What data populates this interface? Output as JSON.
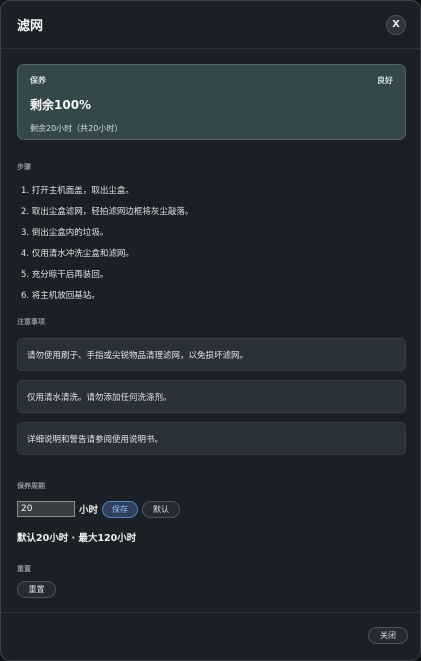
{
  "dialog": {
    "title": "滤网",
    "close_x": "X"
  },
  "status": {
    "label": "保养",
    "condition": "良好",
    "remaining": "剩余100%",
    "detail": "剩余20小时（共20小时）",
    "progress_percent": 100
  },
  "steps": {
    "label": "步骤",
    "items": [
      "1. 打开主机面盖，取出尘盒。",
      "2. 取出尘盒滤网，轻拍滤网边框将灰尘敲落。",
      "3. 倒出尘盒内的垃圾。",
      "4. 仅用清水冲洗尘盒和滤网。",
      "5. 充分晾干后再装回。",
      "6. 将主机放回基站。"
    ]
  },
  "notes": {
    "label": "注意事项",
    "items": [
      "请勿使用刷子、手指或尖锐物品清理滤网，以免损坏滤网。",
      "仅用清水清洗。请勿添加任何洗涤剂。",
      "详细说明和警告请参阅使用说明书。"
    ]
  },
  "period": {
    "label": "保养周期",
    "value": "20",
    "unit": "小时",
    "save_label": "保存",
    "default_label": "默认",
    "range_text": "默认20小时 · 最大120小时"
  },
  "reset": {
    "label": "重置",
    "button_label": "重置"
  },
  "footer": {
    "close_label": "关闭"
  }
}
